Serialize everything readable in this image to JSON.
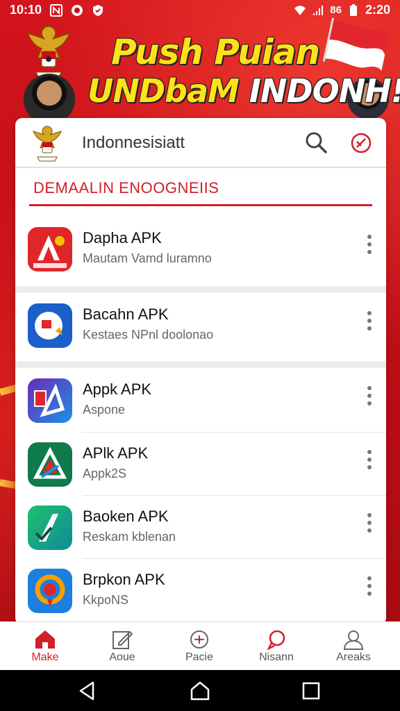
{
  "status_bar": {
    "time_left": "10:10",
    "network": "86",
    "time_right": "2:20"
  },
  "banner": {
    "line1": "Push Puian",
    "line2_part1": "UNDbaM ",
    "line2_part2": "INDONH!"
  },
  "header": {
    "title": "Indonnesisiatt"
  },
  "section": {
    "label": "DEMAALIN ENOOGNEIIS"
  },
  "apps": [
    {
      "name": "Dapha APK",
      "subtitle": "Mautam Vamd luramno",
      "icon": "app-icon-red",
      "icon_color": "#e0262b"
    },
    {
      "name": "Bacahn APK",
      "subtitle": "Kestaes NPnl doolonao",
      "icon": "app-icon-blue",
      "icon_color": "#1b5fc9"
    },
    {
      "name": "Appk APK",
      "subtitle": "Aspone",
      "icon": "app-icon-purple-blue",
      "icon_color": "#3b3fc6"
    },
    {
      "name": "APlk APK",
      "subtitle": "Appk2S",
      "icon": "app-icon-green",
      "icon_color": "#0f7a4c"
    },
    {
      "name": "Baoken APK",
      "subtitle": "Reskam kblenan",
      "icon": "app-icon-teal",
      "icon_color": "#14a86a"
    },
    {
      "name": "Brpkon APK",
      "subtitle": "KkpoNS",
      "icon": "app-icon-orange-blue",
      "icon_color": "#1c7fe0"
    }
  ],
  "bottom_nav": [
    {
      "label": "Make",
      "icon": "home-icon",
      "active": true
    },
    {
      "label": "Aoue",
      "icon": "edit-icon",
      "active": false
    },
    {
      "label": "Pacie",
      "icon": "compass-icon",
      "active": false
    },
    {
      "label": "Nisann",
      "icon": "chat-icon",
      "active": false
    },
    {
      "label": "Areaks",
      "icon": "profile-icon",
      "active": false
    }
  ],
  "colors": {
    "brand_red": "#d0202a",
    "banner_yellow": "#ffe21a"
  }
}
